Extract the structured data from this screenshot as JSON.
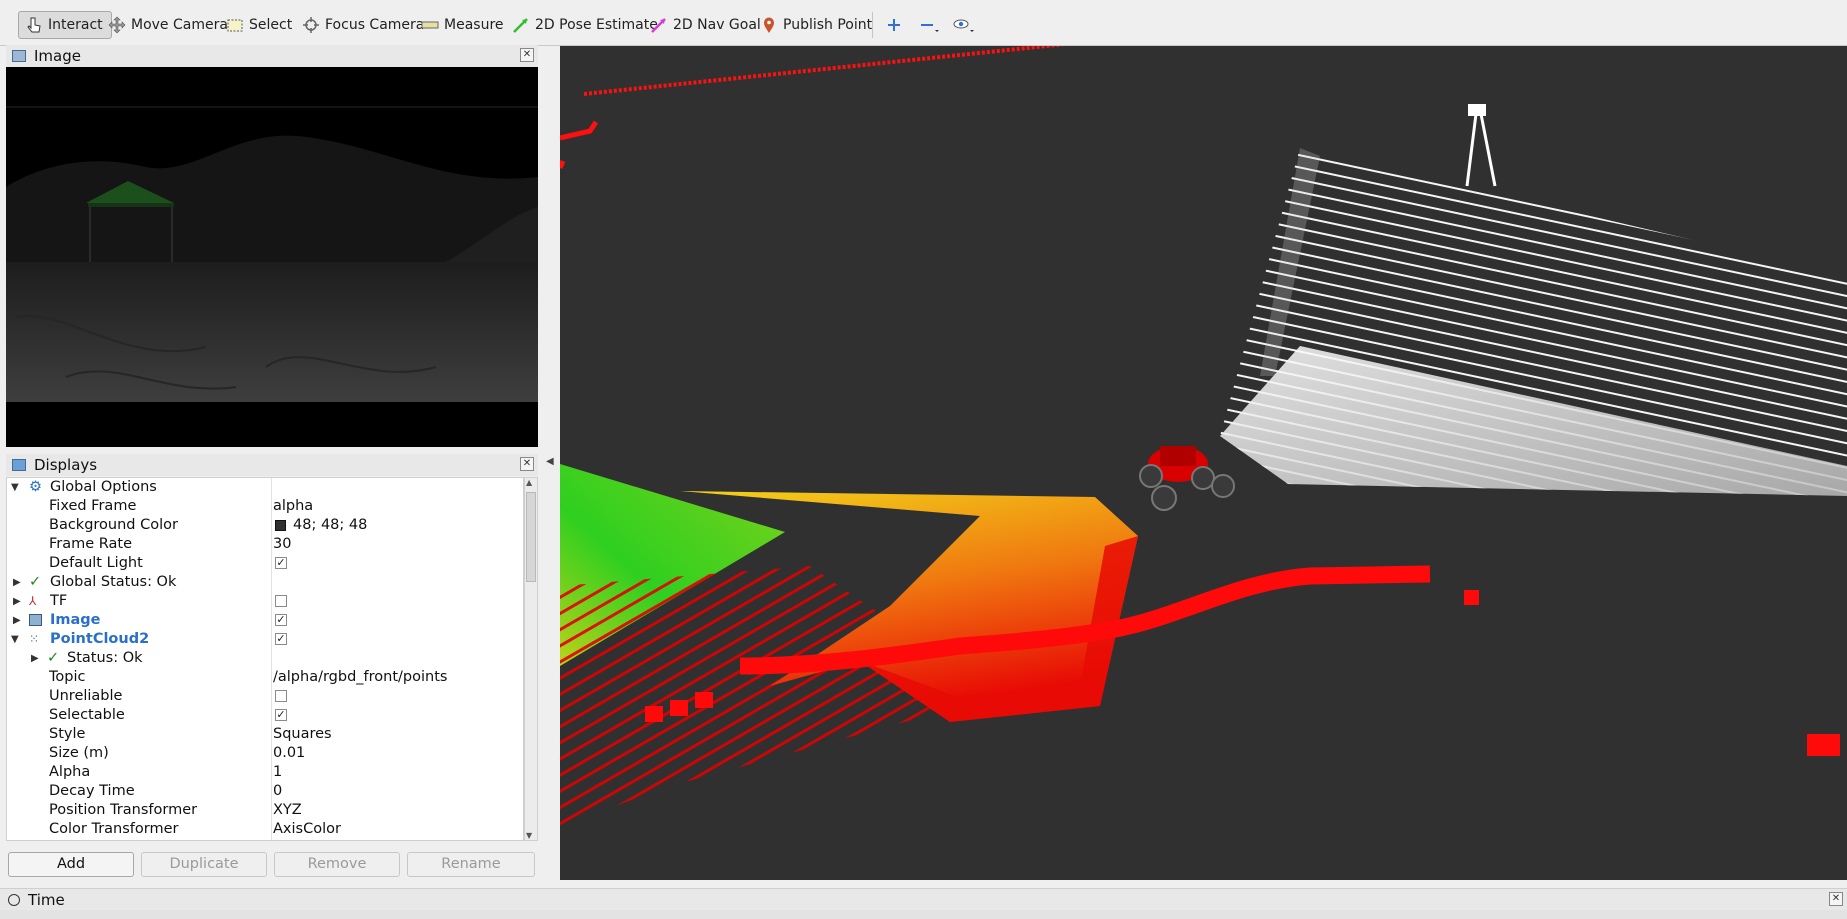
{
  "toolbar": {
    "interact": "Interact",
    "move_camera": "Move Camera",
    "select": "Select",
    "focus_camera": "Focus Camera",
    "measure": "Measure",
    "pose_estimate": "2D Pose Estimate",
    "nav_goal": "2D Nav Goal",
    "publish_point": "Publish Point"
  },
  "image_panel": {
    "title": "Image"
  },
  "displays_panel": {
    "title": "Displays",
    "rows": {
      "global_options": "Global Options",
      "fixed_frame": {
        "label": "Fixed Frame",
        "value": "alpha"
      },
      "background_color": {
        "label": "Background Color",
        "value": "48; 48; 48",
        "swatch": "#303030"
      },
      "frame_rate": {
        "label": "Frame Rate",
        "value": "30"
      },
      "default_light": {
        "label": "Default Light",
        "checked": true
      },
      "global_status": "Global Status: Ok",
      "tf": {
        "label": "TF",
        "checked": false
      },
      "image": {
        "label": "Image",
        "checked": true
      },
      "pointcloud2": {
        "label": "PointCloud2",
        "checked": true
      },
      "status_ok": "Status: Ok",
      "topic": {
        "label": "Topic",
        "value": "/alpha/rgbd_front/points"
      },
      "unreliable": {
        "label": "Unreliable",
        "checked": false
      },
      "selectable": {
        "label": "Selectable",
        "checked": true
      },
      "style": {
        "label": "Style",
        "value": "Squares"
      },
      "size": {
        "label": "Size (m)",
        "value": "0.01"
      },
      "alpha": {
        "label": "Alpha",
        "value": "1"
      },
      "decay_time": {
        "label": "Decay Time",
        "value": "0"
      },
      "position_transformer": {
        "label": "Position Transformer",
        "value": "XYZ"
      },
      "color_transformer": {
        "label": "Color Transformer",
        "value": "AxisColor"
      }
    }
  },
  "buttons": {
    "add": "Add",
    "duplicate": "Duplicate",
    "remove": "Remove",
    "rename": "Rename"
  },
  "time_panel": {
    "title": "Time"
  },
  "colors": {
    "viewport_bg": "#303030",
    "accent_blue": "#2a6fc9",
    "ok_green": "#1a8a1a"
  },
  "icons": [
    "cursor-icon",
    "move-camera-icon",
    "select-icon",
    "focus-camera-icon",
    "measure-icon",
    "pose-estimate-icon",
    "nav-goal-icon",
    "publish-point-icon",
    "zoom-in-icon",
    "zoom-out-icon",
    "eye-icon"
  ]
}
